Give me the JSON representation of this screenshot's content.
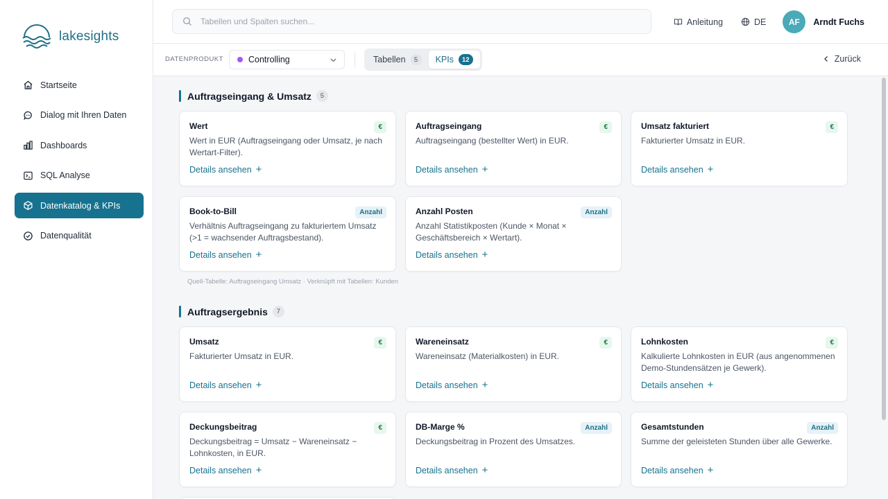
{
  "app": {
    "name": "lakesights"
  },
  "nav": {
    "items": [
      {
        "label": "Startseite",
        "icon": "home-icon",
        "active": false
      },
      {
        "label": "Dialog mit Ihren Daten",
        "icon": "chat-bubble-icon",
        "active": false
      },
      {
        "label": "Dashboards",
        "icon": "bar-chart-icon",
        "active": false
      },
      {
        "label": "SQL Analyse",
        "icon": "terminal-icon",
        "active": false
      },
      {
        "label": "Datenkatalog & KPIs",
        "icon": "cube-icon",
        "active": true
      },
      {
        "label": "Datenqualität",
        "icon": "check-circle-icon",
        "active": false
      }
    ]
  },
  "header": {
    "search_placeholder": "Tabellen und Spalten suchen...",
    "guide_label": "Anleitung",
    "language": "DE",
    "user_initials": "AF",
    "user_name": "Arndt Fuchs"
  },
  "toolbar": {
    "dataproduct_label": "DATENPRODUKT",
    "dataproduct_value": "Controlling",
    "dataproduct_color": "#a855f7",
    "tabs": [
      {
        "label": "Tabellen",
        "count": "5",
        "active": false
      },
      {
        "label": "KPIs",
        "count": "12",
        "active": true
      }
    ],
    "back_label": "Zurück"
  },
  "colors": {
    "accent": "#16728f",
    "eur_badge": "#15803d",
    "active_nav": "#16728f"
  },
  "sections": [
    {
      "title": "Auftragseingang & Umsatz",
      "count": "5",
      "source_note": "Quell-Tabelle: Auftragseingang Umsatz · Verknüpft mit Tabellen: Kunden",
      "cards": [
        {
          "title": "Wert",
          "badge": "€",
          "desc": "Wert in EUR (Auftragseingang oder Umsatz, je nach Wertart-Filter).",
          "link": "Details ansehen"
        },
        {
          "title": "Auftragseingang",
          "badge": "€",
          "desc": "Auftragseingang (bestellter Wert) in EUR.",
          "link": "Details ansehen"
        },
        {
          "title": "Umsatz fakturiert",
          "badge": "€",
          "desc": "Fakturierter Umsatz in EUR.",
          "link": "Details ansehen"
        },
        {
          "title": "Book-to-Bill",
          "badge": "Anzahl",
          "desc": "Verhältnis Auftragseingang zu fakturiertem Umsatz (>1 = wachsender Auftragsbestand).",
          "link": "Details ansehen"
        },
        {
          "title": "Anzahl Posten",
          "badge": "Anzahl",
          "desc": "Anzahl Statistikposten (Kunde × Monat × Geschäftsbereich × Wertart).",
          "link": "Details ansehen"
        }
      ]
    },
    {
      "title": "Auftragsergebnis",
      "count": "7",
      "cards": [
        {
          "title": "Umsatz",
          "badge": "€",
          "desc": "Fakturierter Umsatz in EUR.",
          "link": "Details ansehen"
        },
        {
          "title": "Wareneinsatz",
          "badge": "€",
          "desc": "Wareneinsatz (Materialkosten) in EUR.",
          "link": "Details ansehen"
        },
        {
          "title": "Lohnkosten",
          "badge": "€",
          "desc": "Kalkulierte Lohnkosten in EUR (aus angenommenen Demo-Stundensätzen je Gewerk).",
          "link": "Details ansehen"
        },
        {
          "title": "Deckungsbeitrag",
          "badge": "€",
          "desc": "Deckungsbeitrag = Umsatz − Wareneinsatz − Lohnkosten, in EUR.",
          "link": "Details ansehen"
        },
        {
          "title": "DB-Marge %",
          "badge": "Anzahl",
          "desc": "Deckungsbeitrag in Prozent des Umsatzes.",
          "link": "Details ansehen"
        },
        {
          "title": "Gesamtstunden",
          "badge": "Anzahl",
          "desc": "Summe der geleisteten Stunden über alle Gewerke.",
          "link": "Details ansehen"
        }
      ]
    }
  ]
}
